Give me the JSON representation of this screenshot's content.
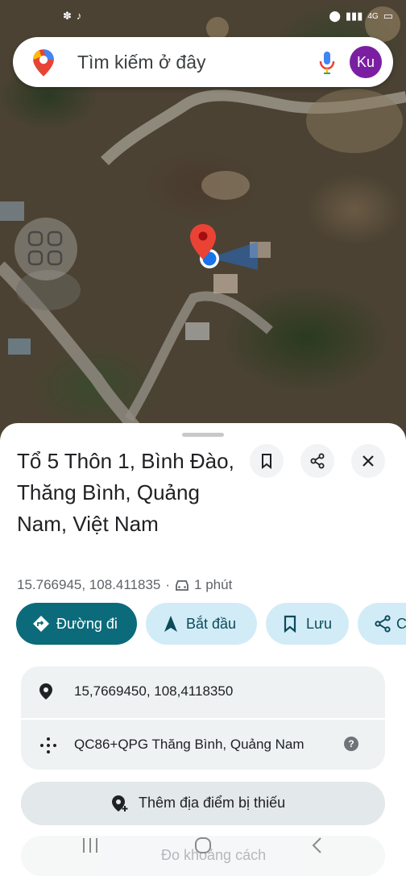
{
  "status_bar": {
    "icons": [
      "flower-icon",
      "tiktok-icon",
      "location-icon",
      "signal-icon",
      "network-icon",
      "battery-icon"
    ],
    "network_label": "4G"
  },
  "search": {
    "placeholder": "Tìm kiếm ở đây",
    "account_initials": "Ku",
    "account_color": "#7b1fa2"
  },
  "map": {
    "icons": [
      "layers-icon",
      "red-pin-icon",
      "my-location-dot-icon"
    ]
  },
  "place": {
    "title": "Tổ 5 Thôn 1, Bình Đào, Thăng Bình, Quảng Nam, Việt Nam",
    "coordinates": "15.766945, 108.411835",
    "separator": "·",
    "travel_time": "1 phút"
  },
  "actions": [
    {
      "label": "Đường đi",
      "icon": "directions-icon"
    },
    {
      "label": "Bắt đầu",
      "icon": "navigation-arrow-icon"
    },
    {
      "label": "Lưu",
      "icon": "bookmark-icon"
    },
    {
      "label": "C",
      "icon": "share-icon"
    }
  ],
  "details": {
    "coordinates": "15,7669450, 108,4118350",
    "plus_code": "QC86+QPG Thăng Bình, Quảng Nam",
    "help_symbol": "?"
  },
  "add_missing_place": "Thêm địa điểm bị thiếu",
  "measure_distance": "Đo khoảng cách",
  "colors": {
    "primary": "#0b6b7a",
    "chip": "#d2ecf7",
    "pin": "#ea4335",
    "location_dot": "#1a73e8"
  }
}
